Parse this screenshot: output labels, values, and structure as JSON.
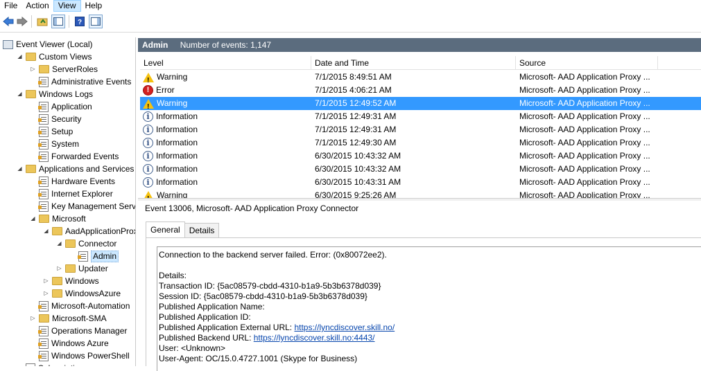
{
  "menu": [
    "File",
    "Action",
    "View",
    "Help"
  ],
  "tree": [
    {
      "label": "Event Viewer (Local)",
      "icon": "computer-icon",
      "indent": 0,
      "toggle": ""
    },
    {
      "label": "Custom Views",
      "icon": "folder-icon",
      "indent": 1,
      "toggle": "expanded"
    },
    {
      "label": "ServerRoles",
      "icon": "folder-icon",
      "indent": 2,
      "toggle": "collapsed"
    },
    {
      "label": "Administrative Events",
      "icon": "log-icon",
      "indent": 2,
      "toggle": ""
    },
    {
      "label": "Windows Logs",
      "icon": "folder-icon",
      "indent": 1,
      "toggle": "expanded"
    },
    {
      "label": "Application",
      "icon": "log-icon",
      "indent": 2,
      "toggle": ""
    },
    {
      "label": "Security",
      "icon": "log-icon",
      "indent": 2,
      "toggle": ""
    },
    {
      "label": "Setup",
      "icon": "log-icon",
      "indent": 2,
      "toggle": ""
    },
    {
      "label": "System",
      "icon": "log-icon",
      "indent": 2,
      "toggle": ""
    },
    {
      "label": "Forwarded Events",
      "icon": "log-icon",
      "indent": 2,
      "toggle": ""
    },
    {
      "label": "Applications and Services Lo",
      "icon": "folder-icon",
      "indent": 1,
      "toggle": "expanded"
    },
    {
      "label": "Hardware Events",
      "icon": "log-icon",
      "indent": 2,
      "toggle": ""
    },
    {
      "label": "Internet Explorer",
      "icon": "log-icon",
      "indent": 2,
      "toggle": ""
    },
    {
      "label": "Key Management Service",
      "icon": "log-icon",
      "indent": 2,
      "toggle": ""
    },
    {
      "label": "Microsoft",
      "icon": "folder-icon",
      "indent": 2,
      "toggle": "expanded"
    },
    {
      "label": "AadApplicationProxy",
      "icon": "folder-icon",
      "indent": 3,
      "toggle": "expanded"
    },
    {
      "label": "Connector",
      "icon": "folder-icon",
      "indent": 4,
      "toggle": "expanded"
    },
    {
      "label": "Admin",
      "icon": "log-icon",
      "indent": 5,
      "toggle": "",
      "selected": true
    },
    {
      "label": "Updater",
      "icon": "folder-icon",
      "indent": 4,
      "toggle": "collapsed"
    },
    {
      "label": "Windows",
      "icon": "folder-icon",
      "indent": 3,
      "toggle": "collapsed"
    },
    {
      "label": "WindowsAzure",
      "icon": "folder-icon",
      "indent": 3,
      "toggle": "collapsed"
    },
    {
      "label": "Microsoft-Automation",
      "icon": "log-icon",
      "indent": 2,
      "toggle": ""
    },
    {
      "label": "Microsoft-SMA",
      "icon": "folder-icon",
      "indent": 2,
      "toggle": "collapsed"
    },
    {
      "label": "Operations Manager",
      "icon": "log-icon",
      "indent": 2,
      "toggle": ""
    },
    {
      "label": "Windows Azure",
      "icon": "log-icon",
      "indent": 2,
      "toggle": ""
    },
    {
      "label": "Windows PowerShell",
      "icon": "log-icon",
      "indent": 2,
      "toggle": ""
    },
    {
      "label": "Subscriptions",
      "icon": "log-icon",
      "indent": 1,
      "toggle": ""
    }
  ],
  "header": {
    "log_name": "Admin",
    "count_text": "Number of events: 1,147"
  },
  "columns": [
    "Level",
    "Date and Time",
    "Source"
  ],
  "events": [
    {
      "level": "Warning",
      "icon": "warning-icon",
      "date": "7/1/2015 8:49:51 AM",
      "source": "Microsoft- AAD Application Proxy ..."
    },
    {
      "level": "Error",
      "icon": "error-icon",
      "date": "7/1/2015 4:06:21 AM",
      "source": "Microsoft- AAD Application Proxy ..."
    },
    {
      "level": "Warning",
      "icon": "warning-icon",
      "date": "7/1/2015 12:49:52 AM",
      "source": "Microsoft- AAD Application Proxy ...",
      "selected": true
    },
    {
      "level": "Information",
      "icon": "info-icon",
      "date": "7/1/2015 12:49:31 AM",
      "source": "Microsoft- AAD Application Proxy ..."
    },
    {
      "level": "Information",
      "icon": "info-icon",
      "date": "7/1/2015 12:49:31 AM",
      "source": "Microsoft- AAD Application Proxy ..."
    },
    {
      "level": "Information",
      "icon": "info-icon",
      "date": "7/1/2015 12:49:30 AM",
      "source": "Microsoft- AAD Application Proxy ..."
    },
    {
      "level": "Information",
      "icon": "info-icon",
      "date": "6/30/2015 10:43:32 AM",
      "source": "Microsoft- AAD Application Proxy ..."
    },
    {
      "level": "Information",
      "icon": "info-icon",
      "date": "6/30/2015 10:43:32 AM",
      "source": "Microsoft- AAD Application Proxy ..."
    },
    {
      "level": "Information",
      "icon": "info-icon",
      "date": "6/30/2015 10:43:31 AM",
      "source": "Microsoft- AAD Application Proxy ..."
    },
    {
      "level": "Warning",
      "icon": "warning-icon",
      "date": "6/30/2015 9:25:26 AM",
      "source": "Microsoft- AAD Application Proxy ..."
    }
  ],
  "detail": {
    "title": "Event 13006, Microsoft- AAD Application Proxy Connector",
    "tabs": [
      "General",
      "Details"
    ],
    "lines": [
      {
        "text": "Connection to the backend server failed. Error: (0x80072ee2)."
      },
      {
        "text": ""
      },
      {
        "text": "Details:"
      },
      {
        "text": "Transaction ID: {5ac08579-cbdd-4310-b1a9-5b3b6378d039}"
      },
      {
        "text": "Session ID: {5ac08579-cbdd-4310-b1a9-5b3b6378d039}"
      },
      {
        "text": "Published Application Name:"
      },
      {
        "text": "Published Application ID:"
      },
      {
        "text": "Published Application External URL: ",
        "link": "https://lyncdiscover.skill.no/"
      },
      {
        "text": "Published Backend URL: ",
        "link": "https://lyncdiscover.skill.no:4443/"
      },
      {
        "text": "User: <Unknown>"
      },
      {
        "text": "User-Agent: OC/15.0.4727.1001 (Skype for Business)"
      }
    ]
  }
}
